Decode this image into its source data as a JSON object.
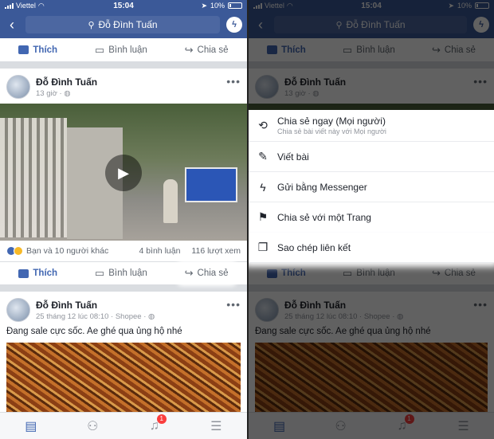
{
  "status": {
    "carrier": "Viettel",
    "time": "15:04",
    "battery": "10%"
  },
  "nav": {
    "search_text": "Đỗ Đình Tuấn"
  },
  "actions": {
    "like": "Thích",
    "comment": "Bình luận",
    "share": "Chia sẻ"
  },
  "post1": {
    "author": "Đỗ Đình Tuấn",
    "time": "13 giờ",
    "reactions": "Bạn và 10 người khác",
    "comments": "4 bình luận",
    "views": "116 lượt xem"
  },
  "post2": {
    "author": "Đỗ Đình Tuấn",
    "sub": "25 tháng 12 lúc 08:10 · Shopee",
    "caption": "Đang sale cực sốc. Ae ghé qua ủng hộ nhé"
  },
  "tabbar": {
    "notification_count": "1"
  },
  "share_menu": [
    {
      "icon": "repost-icon",
      "label": "Chia sẻ ngay (Mọi người)",
      "desc": "Chia sẻ bài viết này với Mọi người"
    },
    {
      "icon": "compose-icon",
      "label": "Viết bài",
      "desc": ""
    },
    {
      "icon": "messenger-icon",
      "label": "Gửi bằng Messenger",
      "desc": ""
    },
    {
      "icon": "flag-icon",
      "label": "Chia sẻ với một Trang",
      "desc": ""
    },
    {
      "icon": "copy-link-icon",
      "label": "Sao chép liên kết",
      "desc": ""
    }
  ],
  "colors": {
    "brand": "#3b5998",
    "like_blue": "#4267b2",
    "badge_red": "#fa3e3e"
  }
}
